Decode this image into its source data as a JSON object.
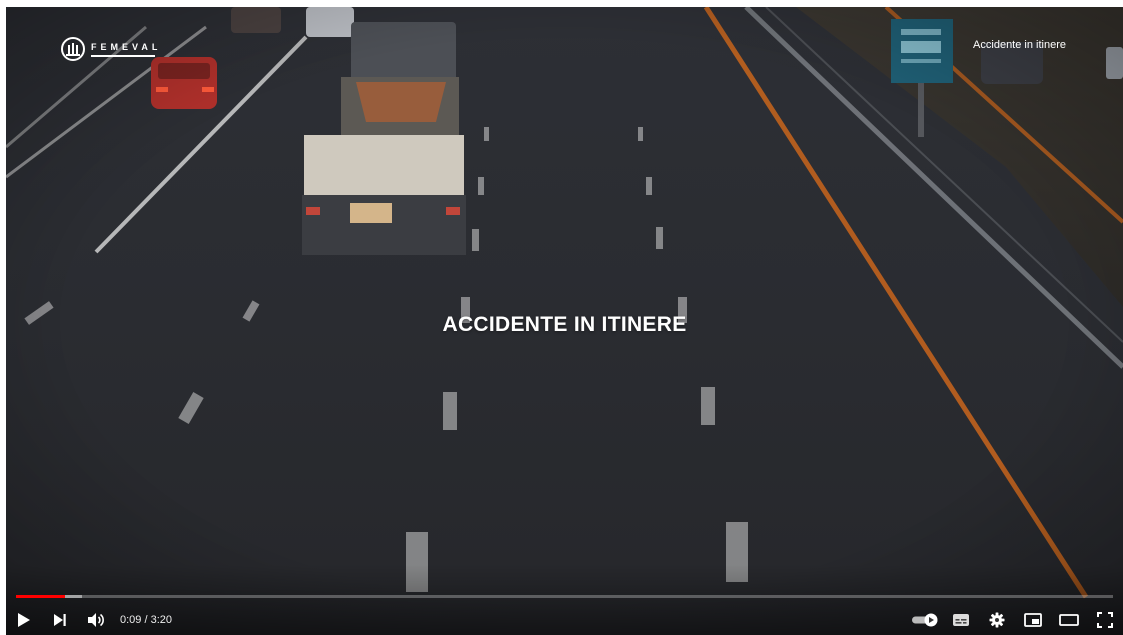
{
  "player": {
    "brand": "FEMEVAL",
    "video_title": "Accidente in itinere",
    "overlay_caption": "ACCIDENTE IN ITINERE",
    "current_time": "0:09",
    "duration": "3:20",
    "time_display": "0:09 / 3:20",
    "progress_played_fraction": 0.045,
    "progress_loaded_fraction": 0.06,
    "accent_color": "#ff0000",
    "autoplay_on": true
  },
  "controls": {
    "left": [
      {
        "name": "play-icon"
      },
      {
        "name": "next-icon"
      },
      {
        "name": "volume-icon"
      }
    ],
    "right": [
      {
        "name": "autoplay-toggle-icon"
      },
      {
        "name": "subtitles-icon"
      },
      {
        "name": "settings-icon"
      },
      {
        "name": "miniplayer-icon"
      },
      {
        "name": "theater-mode-icon"
      },
      {
        "name": "fullscreen-icon"
      }
    ]
  }
}
